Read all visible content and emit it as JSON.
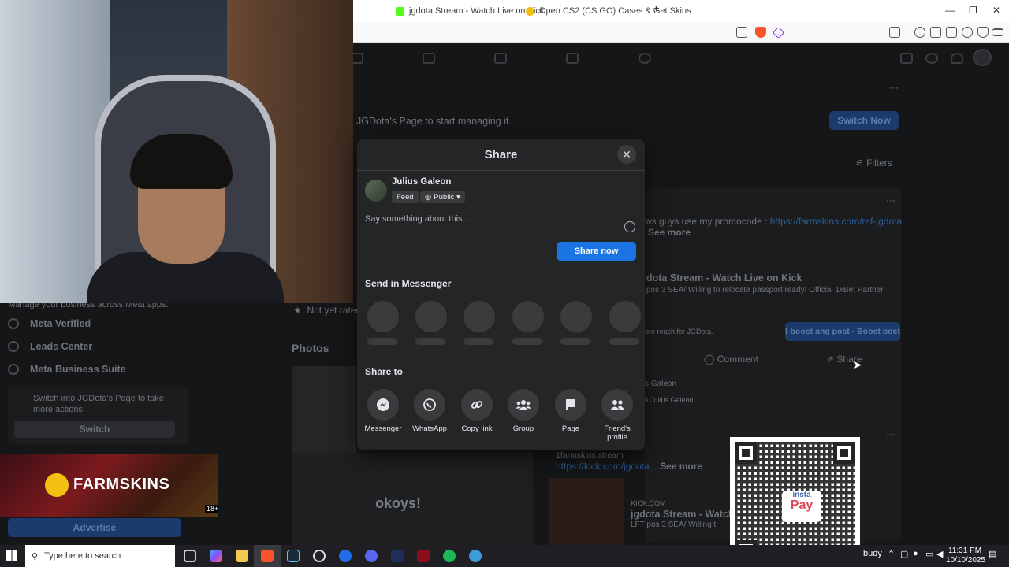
{
  "browser": {
    "tabs": [
      {
        "label": "jgdota Stream - Watch Live on Kick",
        "icon": "kick-icon",
        "color": "#53fc18"
      },
      {
        "label": "Open CS2 (CS:GO) Cases & Get Skins",
        "icon": "farmskins-icon",
        "color": "#f2c112"
      }
    ],
    "new_tab": "+"
  },
  "background": {
    "banner_text": "JGDota's Page to start managing it.",
    "switch_now": "Switch Now",
    "filters": "Filters",
    "post_text": "ws guys use my promocode : ",
    "post_link": "https://farmskins.com/ref-jgdota",
    "see_more": "See more",
    "link_title": "dota Stream - Watch Live on Kick",
    "link_desc": "pos 3 SEA/ Willing to relocate passport ready! Official 1xBet Partner",
    "reach_text": "ore reach for JGDota.",
    "boost_button": "I-boost ang post · Boost post",
    "comment": "Comment",
    "share": "Share",
    "commenter": "s Galeon",
    "comment_text": "s Julius Galeon.",
    "post2_text": "1farmskins stream",
    "post2_link": "https://kick.com/jgdota",
    "post2_domain": "KICK.COM",
    "post2_title": "jgdota Stream - Watch L",
    "post2_desc": "LFT pos 3 SEA/ Willing t",
    "not_yet_rated": "Not yet rated",
    "photos": "Photos",
    "okoys": "okoys!",
    "sidebar": {
      "manage_text": "Manage your business across Meta apps.",
      "items": [
        "Meta Verified",
        "Leads Center",
        "Meta Business Suite"
      ],
      "switch_prompt": "Switch into JGDota's Page to take more actions",
      "switch_button": "Switch",
      "advertise": "Advertise"
    }
  },
  "farmskins": {
    "brand": "FARMSKINS",
    "age": "18+"
  },
  "share_dialog": {
    "title": "Share",
    "user_name": "Julius Galeon",
    "audience": "Feed",
    "privacy": "Public",
    "placeholder": "Say something about this...",
    "share_now": "Share now",
    "send_in_messenger": "Send in Messenger",
    "share_to": "Share to",
    "targets": [
      {
        "label": "Messenger",
        "icon": "messenger-icon"
      },
      {
        "label": "WhatsApp",
        "icon": "whatsapp-icon"
      },
      {
        "label": "Copy link",
        "icon": "link-icon"
      },
      {
        "label": "Group",
        "icon": "group-icon"
      },
      {
        "label": "Page",
        "icon": "flag-icon"
      },
      {
        "label": "Friend's profile",
        "icon": "friends-icon"
      }
    ]
  },
  "qr": {
    "brand_top": "insta",
    "brand_bottom": "Pay"
  },
  "taskbar": {
    "search_placeholder": "Type here to search",
    "weather": "budy",
    "time": "11:31 PM",
    "date": "10/10/2025"
  },
  "colors": {
    "accent": "#1b74e4",
    "modal_bg": "#242526"
  }
}
